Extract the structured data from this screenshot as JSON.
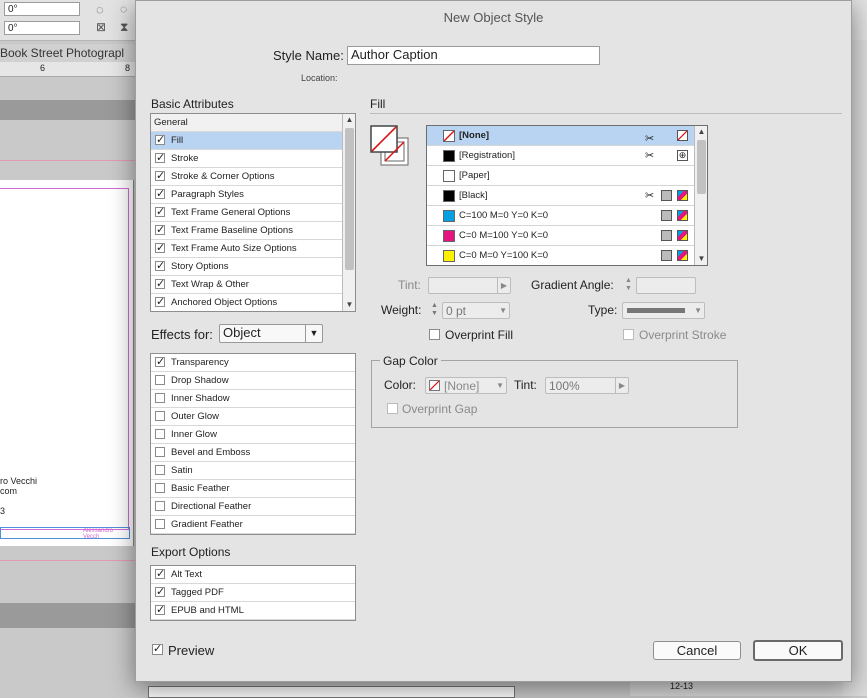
{
  "background": {
    "rotation_1": "0°",
    "rotation_2": "0°",
    "doc_tab": "Book Street Photograpl",
    "ruler_marks": [
      "6",
      "8"
    ],
    "snippet_lines": [
      "ro Vecchi",
      "com",
      "3"
    ],
    "caption_frame_text": "Alessandro Vecch",
    "page_label": "12-13"
  },
  "dialog": {
    "title": "New Object Style",
    "style_name_label": "Style Name:",
    "style_name_value": "Author Caption",
    "location_label": "Location:",
    "basic_attributes": {
      "heading": "Basic Attributes",
      "general_label": "General",
      "items": [
        {
          "label": "Fill",
          "checked": "✓"
        },
        {
          "label": "Stroke",
          "checked": "✓"
        },
        {
          "label": "Stroke & Corner Options",
          "checked": "✓"
        },
        {
          "label": "Paragraph Styles",
          "checked": "✓"
        },
        {
          "label": "Text Frame General Options",
          "checked": "✓"
        },
        {
          "label": "Text Frame Baseline Options",
          "checked": "✓"
        },
        {
          "label": "Text Frame Auto Size Options",
          "checked": "✓"
        },
        {
          "label": "Story Options",
          "checked": "✓"
        },
        {
          "label": "Text Wrap & Other",
          "checked": "✓"
        },
        {
          "label": "Anchored Object Options",
          "checked": "✓"
        }
      ]
    },
    "effects": {
      "label": "Effects for:",
      "value": "Object",
      "items": [
        {
          "label": "Transparency",
          "checked": "✓"
        },
        {
          "label": "Drop Shadow",
          "checked": ""
        },
        {
          "label": "Inner Shadow",
          "checked": ""
        },
        {
          "label": "Outer Glow",
          "checked": ""
        },
        {
          "label": "Inner Glow",
          "checked": ""
        },
        {
          "label": "Bevel and Emboss",
          "checked": ""
        },
        {
          "label": "Satin",
          "checked": ""
        },
        {
          "label": "Basic Feather",
          "checked": ""
        },
        {
          "label": "Directional Feather",
          "checked": ""
        },
        {
          "label": "Gradient Feather",
          "checked": ""
        }
      ]
    },
    "export": {
      "heading": "Export Options",
      "items": [
        {
          "label": "Alt Text",
          "checked": "✓"
        },
        {
          "label": "Tagged PDF",
          "checked": "✓"
        },
        {
          "label": "EPUB and HTML",
          "checked": "✓"
        }
      ]
    },
    "fill": {
      "heading": "Fill",
      "swatches": [
        {
          "label": "[None]",
          "color": "none",
          "process_icon": "none-icon"
        },
        {
          "label": "[Registration]",
          "color": "#000000",
          "process_icon": "registration-icon"
        },
        {
          "label": "[Paper]",
          "color": "#ffffff",
          "process_icon": ""
        },
        {
          "label": "[Black]",
          "color": "#000000",
          "process_icon": "cmyk-icon"
        },
        {
          "label": "C=100 M=0 Y=0 K=0",
          "color": "#00a0e3",
          "process_icon": "cmyk-icon"
        },
        {
          "label": "C=0 M=100 Y=0 K=0",
          "color": "#e4157f",
          "process_icon": "cmyk-icon"
        },
        {
          "label": "C=0 M=0 Y=100 K=0",
          "color": "#fff000",
          "process_icon": "cmyk-icon"
        }
      ],
      "tint_label": "Tint:",
      "gradient_angle_label": "Gradient Angle:",
      "weight_label": "Weight:",
      "weight_value": "0 pt",
      "type_label": "Type:",
      "overprint_fill": "Overprint Fill",
      "overprint_stroke": "Overprint Stroke"
    },
    "gap": {
      "heading": "Gap Color",
      "color_label": "Color:",
      "color_value": "[None]",
      "tint_label": "Tint:",
      "tint_value": "100%",
      "overprint_gap": "Overprint Gap"
    },
    "preview": {
      "label": "Preview",
      "checked": "✓"
    },
    "cancel_label": "Cancel",
    "ok_label": "OK"
  }
}
